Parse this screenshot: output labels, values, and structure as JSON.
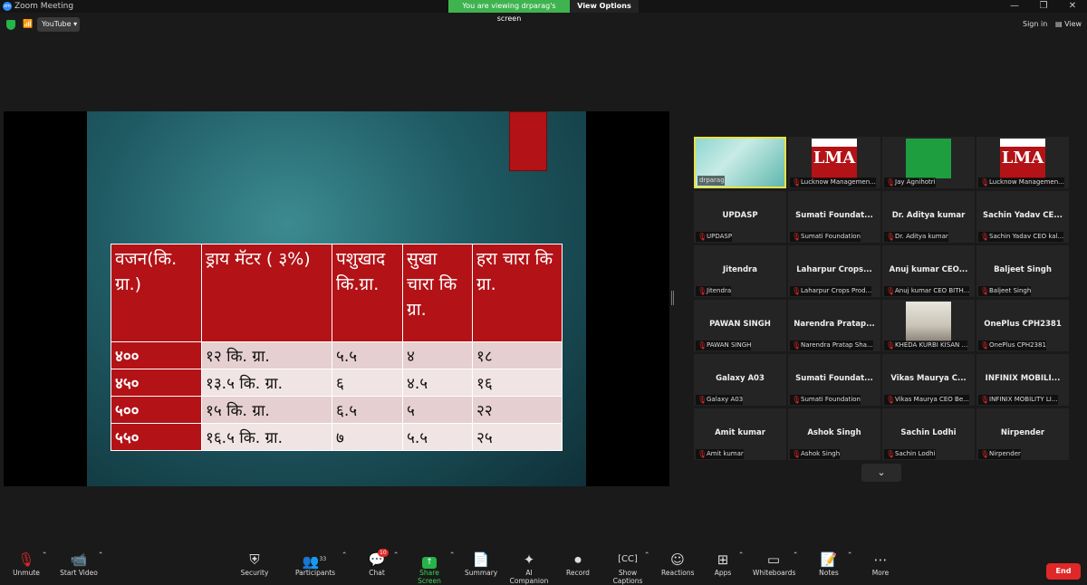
{
  "window": {
    "title": "Zoom Meeting",
    "logo": "zm",
    "minimize": "—",
    "restore": "❐",
    "close": "✕"
  },
  "banner": {
    "viewing": "You are viewing drparag's screen",
    "view_options": "View Options"
  },
  "topbar": {
    "youtube": "YouTube",
    "sign_in": "Sign in",
    "view": "View"
  },
  "slide": {
    "headers": [
      "वजन(कि. ग्रा.)",
      "ड्राय मॅटर ( ३%)",
      "पशुखाद कि.ग्रा.",
      "सुखा चारा कि ग्रा.",
      "हरा चारा कि ग्रा."
    ],
    "rows": [
      [
        "४००",
        "१२ कि. ग्रा.",
        "५.५",
        "४",
        "१८"
      ],
      [
        "४५०",
        "१३.५ कि. ग्रा.",
        "६",
        "४.५",
        "१६"
      ],
      [
        "५००",
        "१५ कि. ग्रा.",
        "६.५",
        "५",
        "२२"
      ],
      [
        "५५०",
        "१६.५ कि. ग्रा.",
        "७",
        "५.५",
        "२५"
      ]
    ]
  },
  "participants": [
    {
      "name": "",
      "label": "drparag",
      "pic": "cam",
      "active": true
    },
    {
      "name": "",
      "label": "Lucknow Managemen...",
      "pic": "lma"
    },
    {
      "name": "",
      "label": "Jay Agnihotri",
      "pic": "green"
    },
    {
      "name": "",
      "label": "Lucknow Managemen...",
      "pic": "lma"
    },
    {
      "name": "UPDASP",
      "label": "UPDASP"
    },
    {
      "name": "Sumati Foundat...",
      "label": "Sumati Foundation"
    },
    {
      "name": "Dr. Aditya kumar",
      "label": "Dr. Aditya kumar"
    },
    {
      "name": "Sachin Yadav CE...",
      "label": "Sachin Yadav CEO kal..."
    },
    {
      "name": "Jitendra",
      "label": "Jitendra"
    },
    {
      "name": "Laharpur Crops...",
      "label": "Laharpur Crops Prod..."
    },
    {
      "name": "Anuj kumar CEO...",
      "label": "Anuj kumar CEO BITH..."
    },
    {
      "name": "Baljeet Singh",
      "label": "Baljeet Singh"
    },
    {
      "name": "PAWAN SINGH",
      "label": "PAWAN SINGH"
    },
    {
      "name": "Narendra Pratap...",
      "label": "Narendra Pratap Sha..."
    },
    {
      "name": "",
      "label": "KHEDA KURBI KISAN ...",
      "pic": "person"
    },
    {
      "name": "OnePlus CPH2381",
      "label": "OnePlus CPH2381"
    },
    {
      "name": "Galaxy A03",
      "label": "Galaxy A03"
    },
    {
      "name": "Sumati Foundat...",
      "label": "Sumati Foundation"
    },
    {
      "name": "Vikas Maurya C...",
      "label": "Vikas Maurya CEO Be..."
    },
    {
      "name": "INFINIX MOBILI...",
      "label": "INFINIX MOBILITY LI..."
    },
    {
      "name": "Amit kumar",
      "label": "Amit kumar"
    },
    {
      "name": "Ashok Singh",
      "label": "Ashok Singh"
    },
    {
      "name": "Sachin Lodhi",
      "label": "Sachin Lodhi"
    },
    {
      "name": "Nirpender",
      "label": "Nirpender"
    }
  ],
  "controls": {
    "unmute": "Unmute",
    "start_video": "Start Video",
    "security": "Security",
    "participants": "Participants",
    "participants_count": "33",
    "chat": "Chat",
    "chat_badge": "10",
    "share_screen": "Share Screen",
    "summary": "Summary",
    "ai_companion": "AI Companion",
    "record": "Record",
    "show_captions": "Show Captions",
    "reactions": "Reactions",
    "apps": "Apps",
    "whiteboards": "Whiteboards",
    "notes": "Notes",
    "more": "More",
    "end": "End"
  }
}
